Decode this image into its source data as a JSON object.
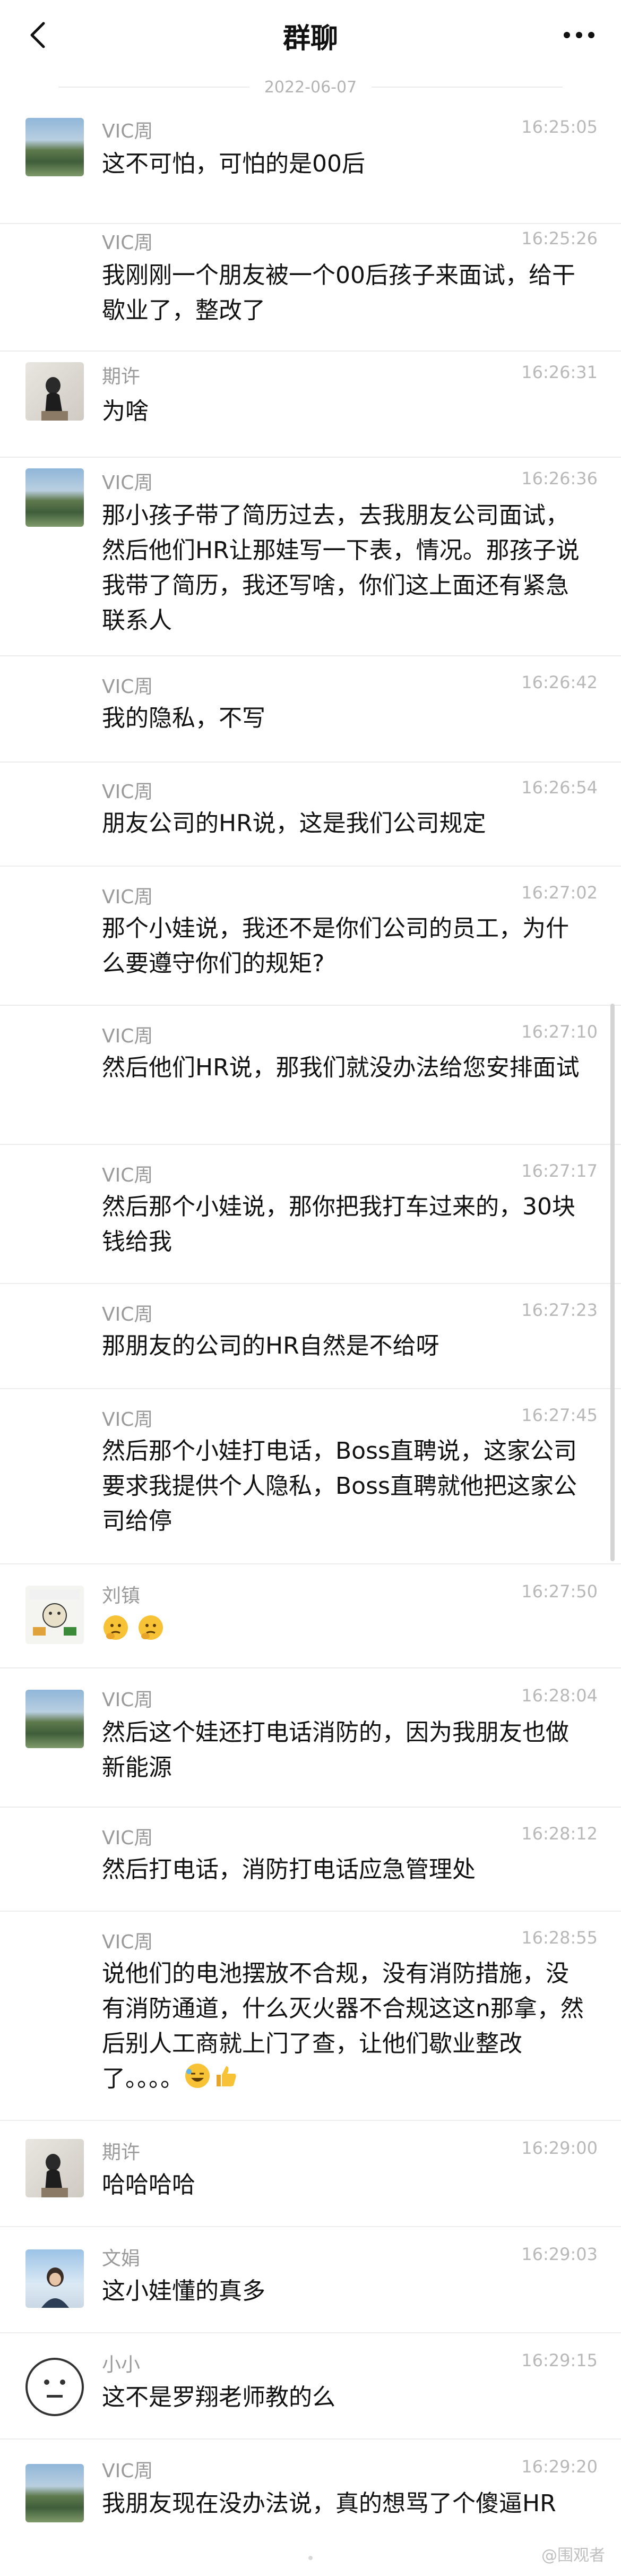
{
  "header": {
    "title": "群聊"
  },
  "date": "2022-06-07",
  "messages": [
    {
      "name": "VIC周",
      "time": "16:25:05",
      "text": "这不可怕，可怕的是00后"
    },
    {
      "name": "VIC周",
      "time": "16:25:26",
      "text": "我刚刚一个朋友被一个00后孩子来面试，给干歇业了，整改了"
    },
    {
      "name": "期许",
      "time": "16:26:31",
      "text": "为啥"
    },
    {
      "name": "VIC周",
      "time": "16:26:36",
      "text": "那小孩子带了简历过去，去我朋友公司面试，然后他们HR让那娃写一下表，情况。那孩子说我带了简历，我还写啥，你们这上面还有紧急联系人"
    },
    {
      "name": "VIC周",
      "time": "16:26:42",
      "text": "我的隐私，不写"
    },
    {
      "name": "VIC周",
      "time": "16:26:54",
      "text": "朋友公司的HR说，这是我们公司规定"
    },
    {
      "name": "VIC周",
      "time": "16:27:02",
      "text": "那个小娃说，我还不是你们公司的员工，为什么要遵守你们的规矩?"
    },
    {
      "name": "VIC周",
      "time": "16:27:10",
      "text": "然后他们HR说，那我们就没办法给您安排面试"
    },
    {
      "name": "VIC周",
      "time": "16:27:17",
      "text": "然后那个小娃说，那你把我打车过来的，30块钱给我"
    },
    {
      "name": "VIC周",
      "time": "16:27:23",
      "text": "那朋友的公司的HR自然是不给呀"
    },
    {
      "name": "VIC周",
      "time": "16:27:45",
      "text": "然后那个小娃打电话，Boss直聘说，这家公司要求我提供个人隐私，Boss直聘就他把这家公司给停"
    },
    {
      "name": "刘镇",
      "time": "16:27:50",
      "text": ""
    },
    {
      "name": "VIC周",
      "time": "16:28:04",
      "text": "然后这个娃还打电话消防的，因为我朋友也做新能源"
    },
    {
      "name": "VIC周",
      "time": "16:28:12",
      "text": "然后打电话，消防打电话应急管理处"
    },
    {
      "name": "VIC周",
      "time": "16:28:55",
      "text": "说他们的电池摆放不合规，没有消防措施，没有消防通道，什么灭火器不合规这这n那拿，然后别人工商就上门了查，让他们歇业整改了。。。。"
    },
    {
      "name": "期许",
      "time": "16:29:00",
      "text": "哈哈哈哈"
    },
    {
      "name": "文娟",
      "time": "16:29:03",
      "text": "这小娃懂的真多"
    },
    {
      "name": "小小",
      "time": "16:29:15",
      "text": "这不是罗翔老师教的么"
    },
    {
      "name": "VIC周",
      "time": "16:29:20",
      "text": "我朋友现在没办法说，真的想骂了个傻逼HR"
    }
  ],
  "icons": {
    "back": "chevron-left-icon",
    "more": "more-dots-icon"
  },
  "watermark": "@围观者",
  "colors": {
    "name": "#9a9a9a",
    "time": "#b8b8b8",
    "divider": "#ececec",
    "text": "#111111"
  }
}
